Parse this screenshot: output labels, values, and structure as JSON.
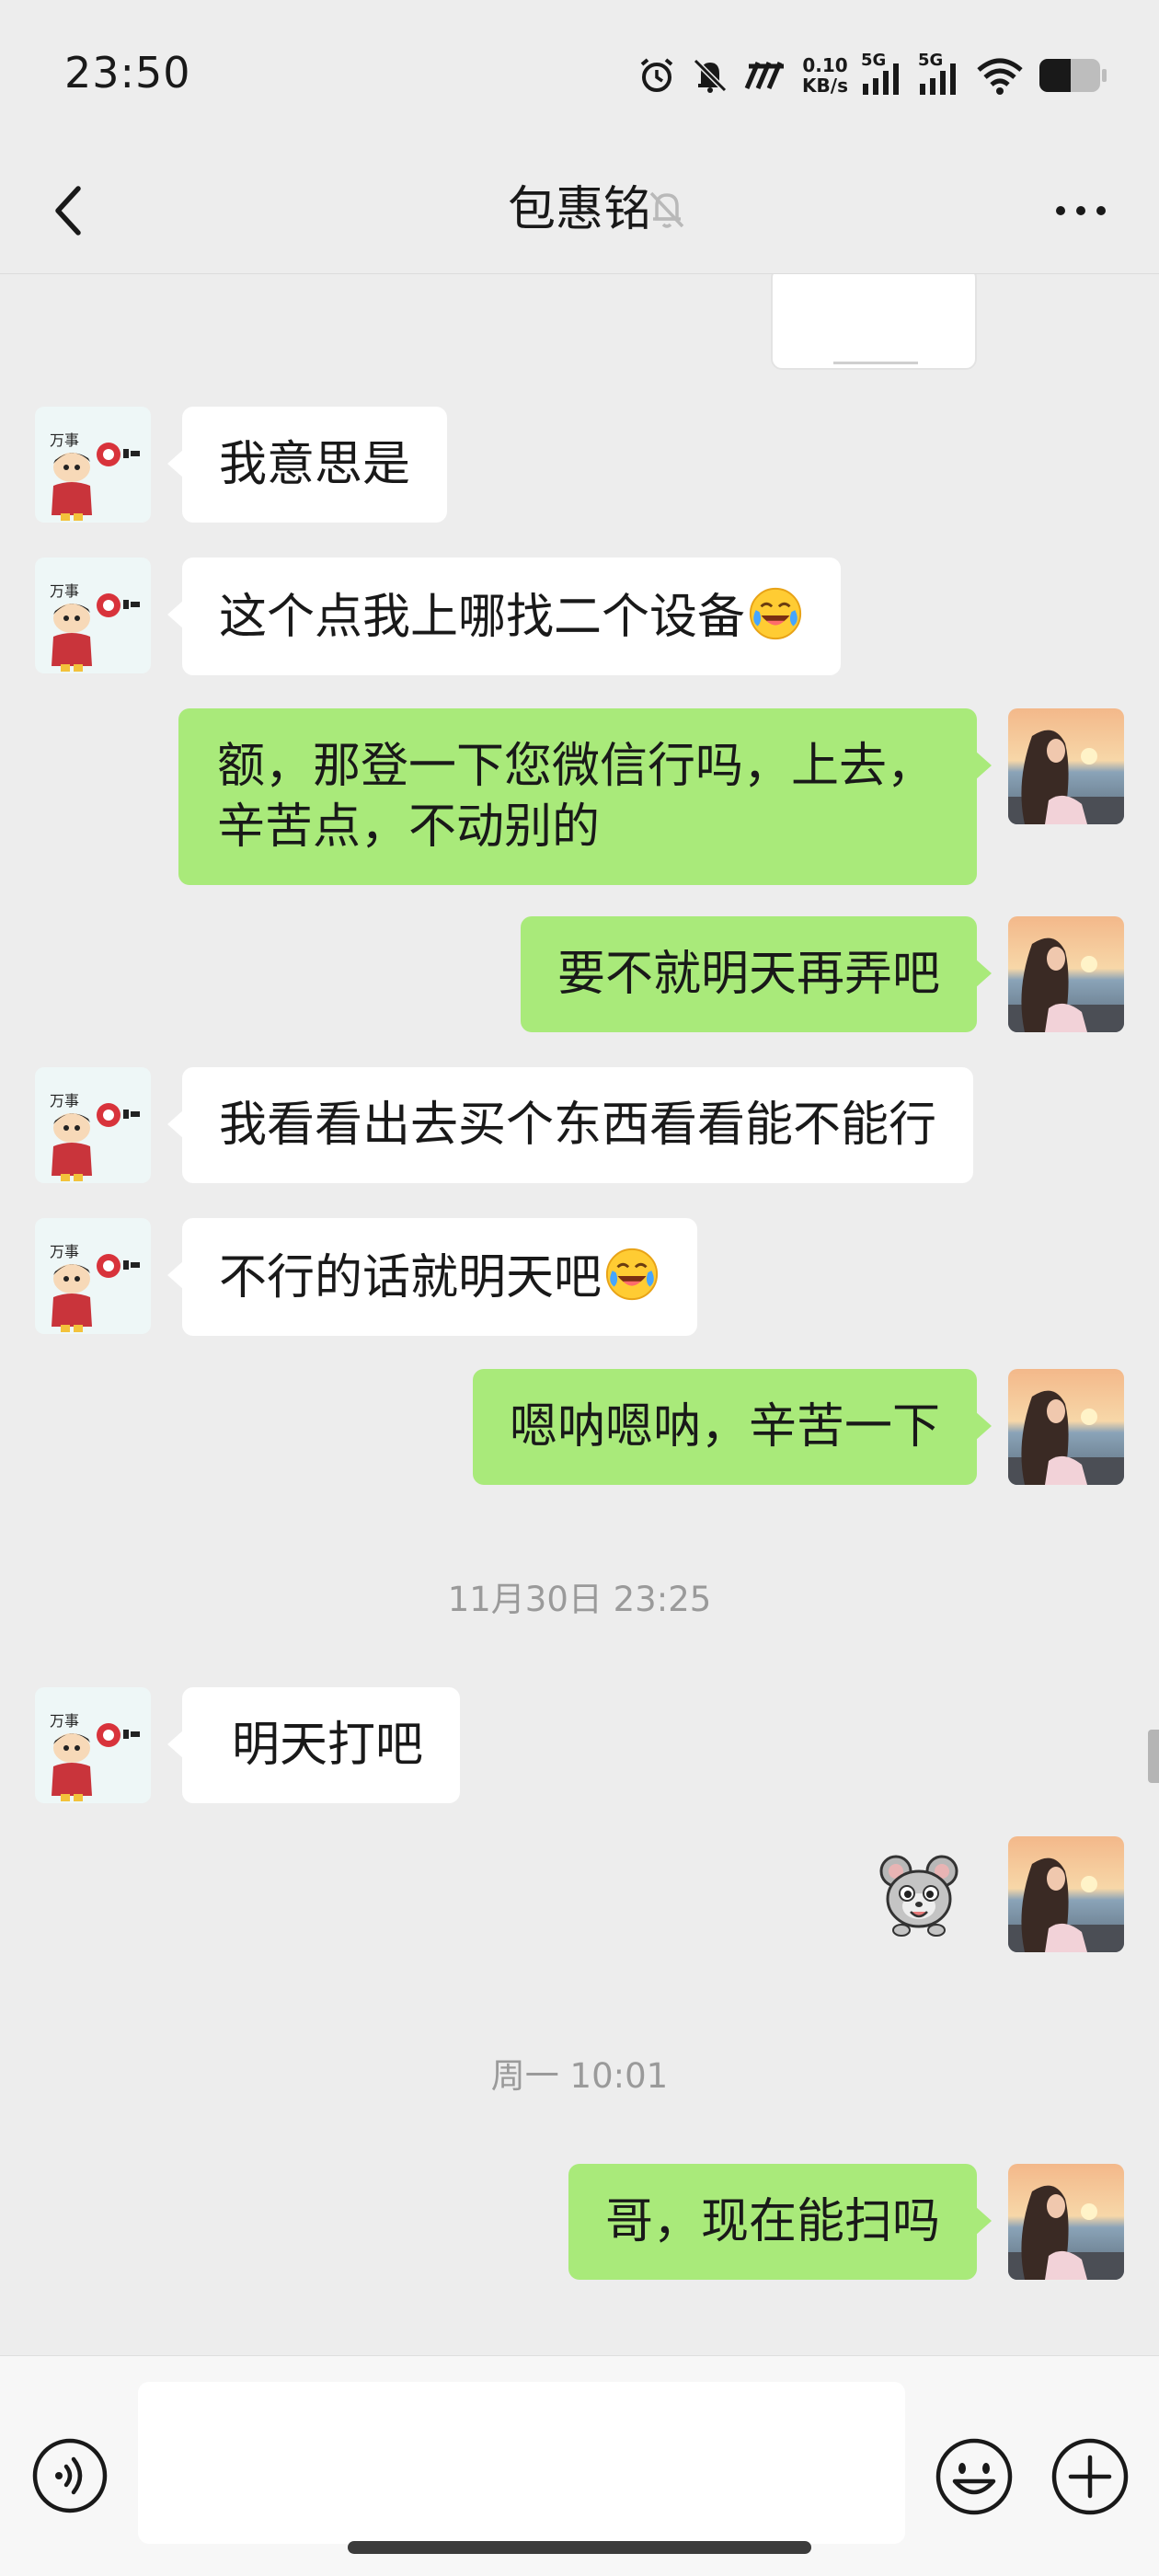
{
  "status_bar": {
    "time": "23:50",
    "net_speed_value": "0.10",
    "net_speed_unit": "KB/s",
    "sim1": "5G",
    "sim2": "5G",
    "icons": [
      "alarm-icon",
      "bell-off-icon",
      "nfc-icon",
      "signal-icon",
      "wifi-icon",
      "battery-icon"
    ]
  },
  "header": {
    "title": "包惠铭",
    "back_icon": "chevron-left-icon",
    "mute_icon": "bell-off-icon",
    "more_icon": "more-dots-icon"
  },
  "messages": [
    {
      "side": "left",
      "text": "我意思是",
      "emoji": false
    },
    {
      "side": "left",
      "text": "这个点我上哪找二个设备",
      "emoji": true
    },
    {
      "side": "right",
      "text": "额，那登一下您微信行吗，上去，辛苦点，不动别的",
      "emoji": false
    },
    {
      "side": "right",
      "text": "要不就明天再弄吧",
      "emoji": false
    },
    {
      "side": "left",
      "text": "我看看出去买个东西看看能不能行",
      "emoji": false
    },
    {
      "side": "left",
      "text": "不行的话就明天吧",
      "emoji": true
    },
    {
      "side": "right",
      "text": "嗯呐嗯呐，辛苦一下",
      "emoji": false
    },
    {
      "type": "timestamp",
      "text": "11月30日 23:25"
    },
    {
      "side": "left",
      "text": "明天打吧",
      "emoji": false
    },
    {
      "side": "right",
      "type": "sticker",
      "sticker": "mouse-sticker"
    },
    {
      "type": "timestamp",
      "text": "周一 10:01"
    },
    {
      "side": "right",
      "text": "哥，现在能扫吗",
      "emoji": false
    }
  ],
  "avatars": {
    "left": "cartoon-boy-avatar",
    "right": "sunset-girl-avatar"
  },
  "input_bar": {
    "voice_icon": "voice-icon",
    "input_value": "",
    "emoji_icon": "smiley-icon",
    "plus_icon": "plus-icon"
  },
  "colors": {
    "background": "#ededed",
    "sent_bubble": "#a9ea7a",
    "received_bubble": "#ffffff",
    "timestamp": "#9a9a9a"
  }
}
